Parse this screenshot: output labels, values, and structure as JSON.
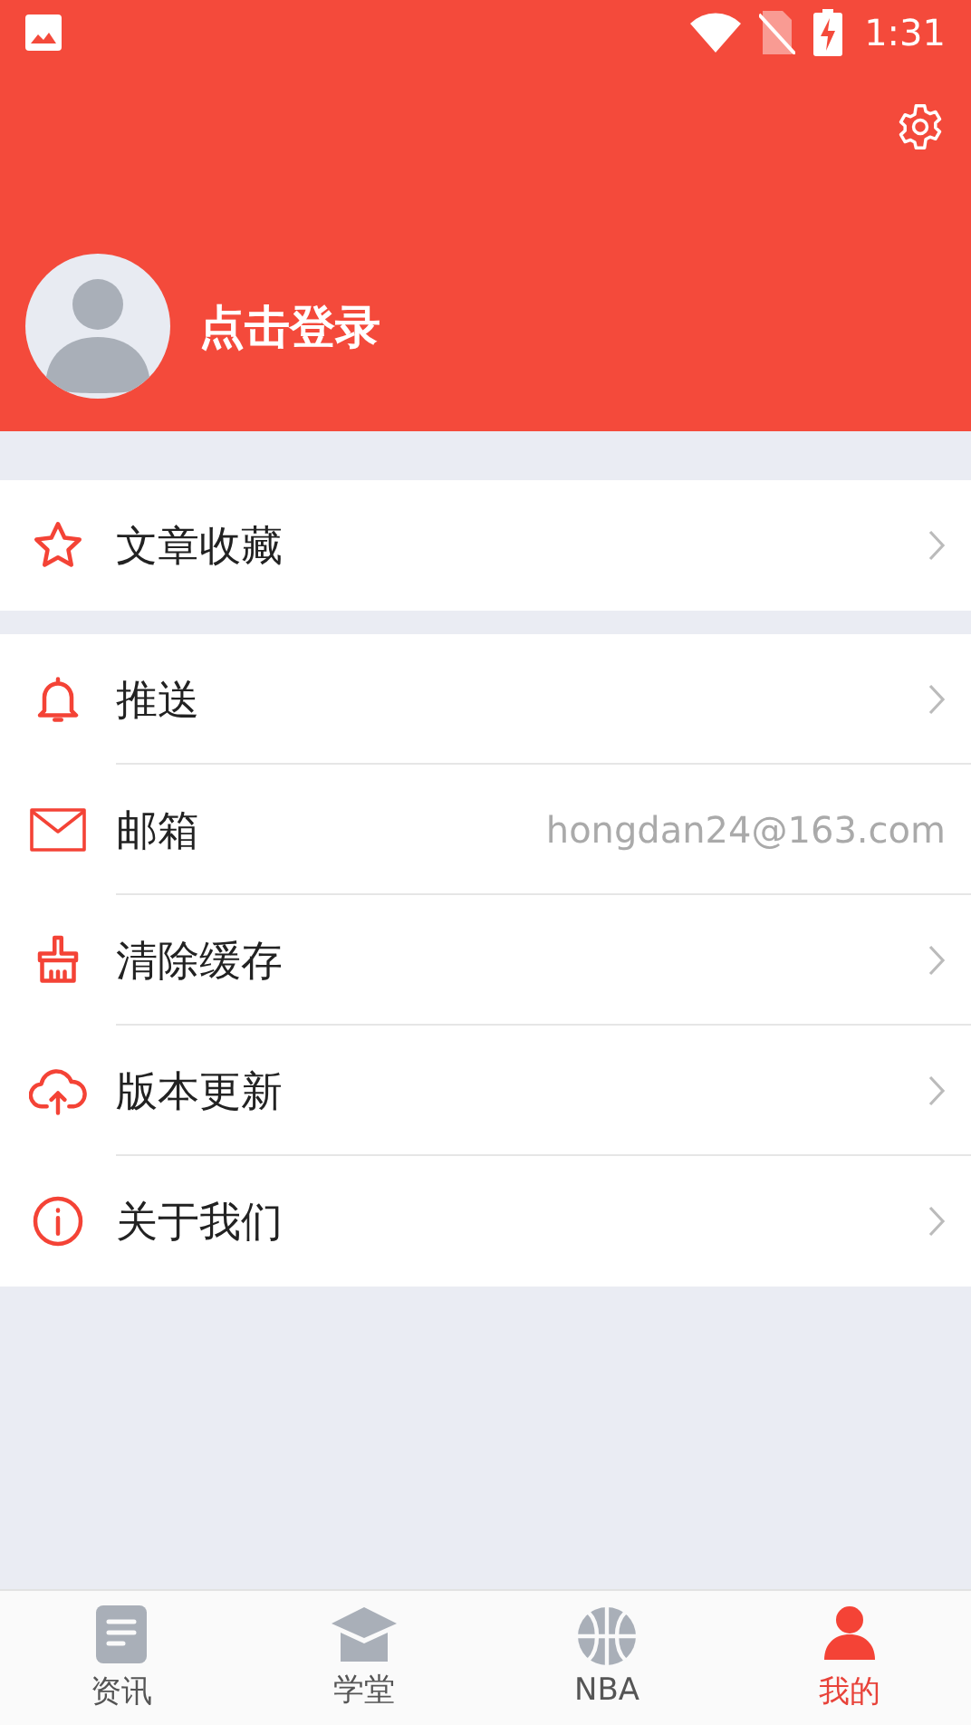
{
  "status_bar": {
    "time": "1:31"
  },
  "profile": {
    "login_label": "点击登录"
  },
  "sections": [
    {
      "items": [
        {
          "kind": "link",
          "label": "文章收藏"
        }
      ]
    },
    {
      "items": [
        {
          "kind": "link",
          "label": "推送"
        },
        {
          "kind": "value",
          "label": "邮箱",
          "value": "hongdan24@163.com"
        },
        {
          "kind": "link",
          "label": "清除缓存"
        },
        {
          "kind": "link",
          "label": "版本更新"
        },
        {
          "kind": "link",
          "label": "关于我们"
        }
      ]
    }
  ],
  "tabs": [
    {
      "label": "资讯",
      "selected": false
    },
    {
      "label": "学堂",
      "selected": false
    },
    {
      "label": "NBA",
      "selected": false
    },
    {
      "label": "我的",
      "selected": true
    }
  ]
}
